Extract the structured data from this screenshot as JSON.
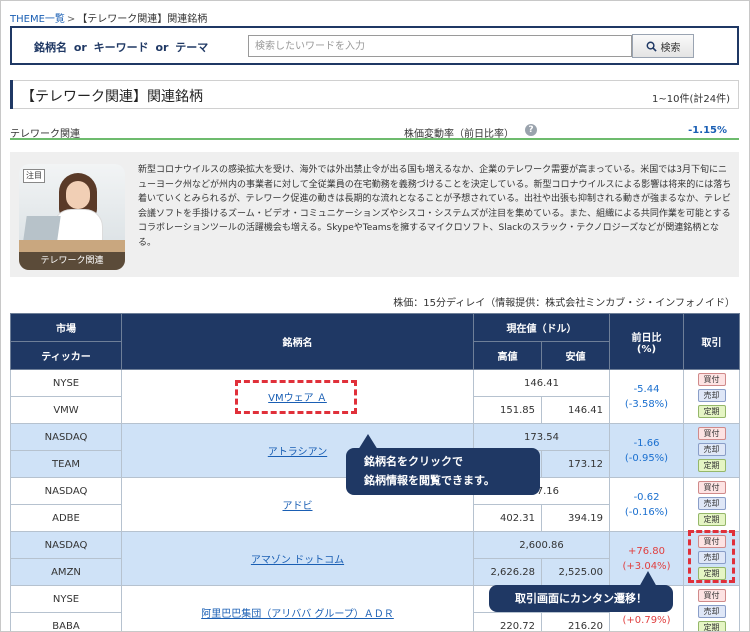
{
  "breadcrumb": {
    "root": "THEME一覧",
    "separator": ">",
    "current": "【テレワーク関連】関連銘柄"
  },
  "search": {
    "label": "銘柄名 or キーワード or テーマ",
    "placeholder": "検索したいワードを入力",
    "button_label": "検索"
  },
  "heading": {
    "title": "【テレワーク関連】関連銘柄",
    "count": "1~10件(計24件)"
  },
  "theme": {
    "name": "テレワーク関連",
    "change_label": "株価変動率（前日比率）",
    "change_value": "-1.15%"
  },
  "description": {
    "thumb_tag": "注目",
    "thumb_caption": "テレワーク関連",
    "text": "新型コロナウイルスの感染拡大を受け、海外では外出禁止令が出る国も増えるなか、企業のテレワーク需要が高まっている。米国では3月下旬にニューヨーク州などが州内の事業者に対して全従業員の在宅勤務を義務づけることを決定している。新型コロナウイルスによる影響は将来的には落ち着いていくとみられるが、テレワーク促進の動きは長期的な流れとなることが予想されている。出社や出張も抑制される動きが強まるなか、テレビ会議ソフトを手掛けるズーム・ビデオ・コミュニケーションズやシスコ・システムズが注目を集めている。また、組織による共同作業を可能とするコラボレーションツールの活躍機会も増える。SkypeやTeamsを擁するマイクロソフト、Slackのスラック・テクノロジーズなどが関連銘柄となる。"
  },
  "delay_note": "株価：15分ディレイ（情報提供：株式会社ミンカブ・ジ・インフォノイド）",
  "table": {
    "headers": {
      "market": "市場",
      "ticker": "ティッカー",
      "name": "銘柄名",
      "price": "現在値（ドル）",
      "high": "高値",
      "low": "安値",
      "change": "前日比",
      "change_unit": "(%)",
      "trade": "取引"
    },
    "trade_buttons": {
      "buy": "買付",
      "sell": "売却",
      "regular": "定期"
    },
    "rows": [
      {
        "market": "NYSE",
        "ticker": "VMW",
        "name": "VMウェア Ａ",
        "price": "146.41",
        "high": "151.85",
        "low": "146.41",
        "change": "-5.44",
        "change_pct": "(-3.58%)"
      },
      {
        "market": "NASDAQ",
        "ticker": "TEAM",
        "name": "アトラシアン",
        "price": "173.54",
        "high": "",
        "low": "173.12",
        "change": "-1.66",
        "change_pct": "(-0.95%)"
      },
      {
        "market": "NASDAQ",
        "ticker": "ADBE",
        "name": "アドビ",
        "price": "397.16",
        "high": "402.31",
        "low": "394.19",
        "change": "-0.62",
        "change_pct": "(-0.16%)"
      },
      {
        "market": "NASDAQ",
        "ticker": "AMZN",
        "name": "アマゾン ドットコム",
        "price": "2,600.86",
        "high": "2,626.28",
        "low": "2,525.00",
        "change": "+76.80",
        "change_pct": "(+3.04%)"
      },
      {
        "market": "NYSE",
        "ticker": "BABA",
        "name": "阿里巴巴集団（アリババ グループ）ＡＤＲ",
        "price": "",
        "high": "220.72",
        "low": "216.20",
        "change": "",
        "change_pct": "(+0.79%)"
      }
    ]
  },
  "callouts": {
    "name_click": "銘柄名をクリックで\n銘柄情報を閲覧できます。",
    "trade_jump": "取引画面にカンタン遷移！"
  },
  "colors": {
    "header_navy": "#1f3864",
    "link_blue": "#1a5fb4",
    "row_blue": "#cfe2f7",
    "negative": "#1a6fcf",
    "positive": "#e04040",
    "highlight_red": "#e0303a"
  }
}
